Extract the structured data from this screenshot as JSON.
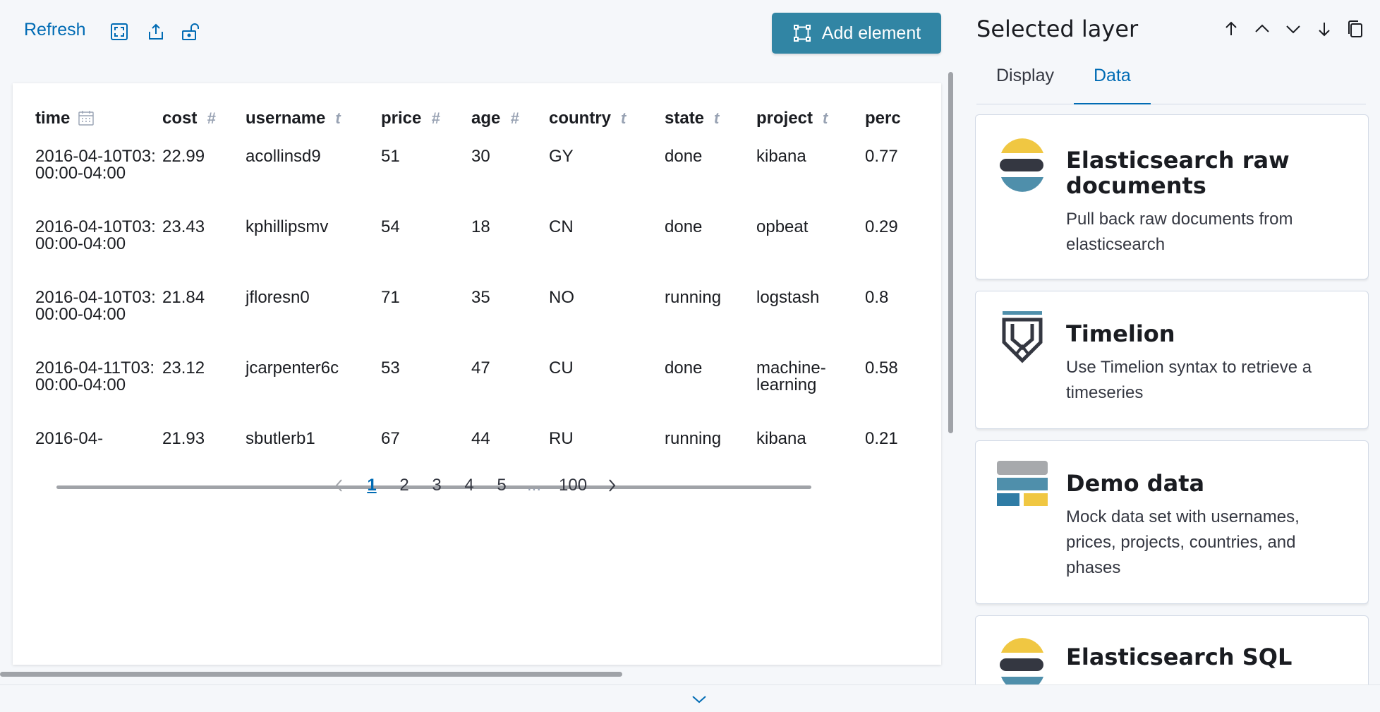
{
  "toolbar": {
    "refresh_label": "Refresh",
    "add_element_label": "Add element"
  },
  "table": {
    "columns": [
      {
        "label": "time",
        "type": "date"
      },
      {
        "label": "cost",
        "type": "#"
      },
      {
        "label": "username",
        "type": "t"
      },
      {
        "label": "price",
        "type": "#"
      },
      {
        "label": "age",
        "type": "#"
      },
      {
        "label": "country",
        "type": "t"
      },
      {
        "label": "state",
        "type": "t"
      },
      {
        "label": "project",
        "type": "t"
      },
      {
        "label": "perc",
        "type": "#"
      }
    ],
    "rows": [
      {
        "time": "2016-04-10T03:00:00-04:00",
        "cost": "22.99",
        "username": "acollinsd9",
        "price": "51",
        "age": "30",
        "country": "GY",
        "state": "done",
        "project": "kibana",
        "perc": "0.77"
      },
      {
        "time": "2016-04-10T03:00:00-04:00",
        "cost": "23.43",
        "username": "kphillipsmv",
        "price": "54",
        "age": "18",
        "country": "CN",
        "state": "done",
        "project": "opbeat",
        "perc": "0.29"
      },
      {
        "time": "2016-04-10T03:00:00-04:00",
        "cost": "21.84",
        "username": "jfloresn0",
        "price": "71",
        "age": "35",
        "country": "NO",
        "state": "running",
        "project": "logstash",
        "perc": "0.8"
      },
      {
        "time": "2016-04-11T03:00:00-04:00",
        "cost": "23.12",
        "username": "jcarpenter6c",
        "price": "53",
        "age": "47",
        "country": "CU",
        "state": "done",
        "project": "machine-learning",
        "perc": "0.58"
      },
      {
        "time": "2016-04-",
        "cost": "21.93",
        "username": "sbutlerb1",
        "price": "67",
        "age": "44",
        "country": "RU",
        "state": "running",
        "project": "kibana",
        "perc": "0.21"
      }
    ]
  },
  "pagination": {
    "pages": [
      "1",
      "2",
      "3",
      "4",
      "5"
    ],
    "ellipsis": "...",
    "last": "100",
    "active": "1"
  },
  "sidebar": {
    "title": "Selected layer",
    "tabs": [
      {
        "label": "Display",
        "active": false
      },
      {
        "label": "Data",
        "active": true
      }
    ],
    "cards": [
      {
        "icon": "elasticsearch-logo-icon",
        "title": "Elasticsearch raw documents",
        "description": "Pull back raw documents from elasticsearch"
      },
      {
        "icon": "timelion-logo-icon",
        "title": "Timelion",
        "description": "Use Timelion syntax to retrieve a timeseries"
      },
      {
        "icon": "demo-data-icon",
        "title": "Demo data",
        "description": "Mock data set with usernames, prices, projects, countries, and phases"
      },
      {
        "icon": "elasticsearch-logo-icon",
        "title": "Elasticsearch SQL",
        "description": ""
      }
    ]
  },
  "colors": {
    "accent": "#006bb4",
    "button": "#3185a4",
    "es_yellow": "#f0c742",
    "es_teal": "#4f8fab",
    "es_dark": "#343741"
  }
}
